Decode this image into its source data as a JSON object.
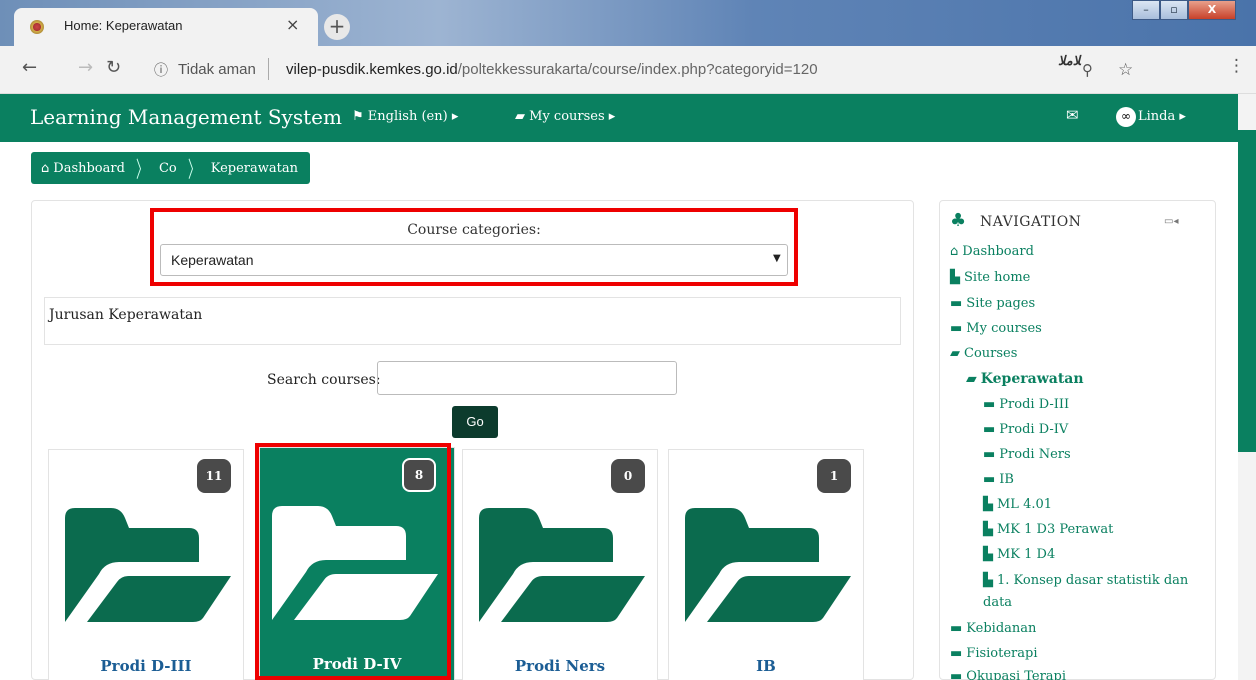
{
  "browser": {
    "tab_title": "Home: Keperawatan",
    "tab_close": "×",
    "new_tab": "+",
    "security": "Tidak aman",
    "url_host": "vilep-pusdik.kemkes.go.id",
    "url_path": "/poltekkessurakarta/course/index.php?categoryid=120",
    "extension_label": "ﻼﻣﻼ",
    "window_buttons": [
      "–",
      "▫",
      "X"
    ]
  },
  "navbar": {
    "brand": "Learning Management System",
    "language": "English (en) ▸",
    "my_courses": "My courses ▸",
    "user": "Linda ▸"
  },
  "breadcrumb": [
    "Dashboard",
    "Co",
    "Keperawatan"
  ],
  "categories": {
    "label": "Course categories:",
    "selected": "Keperawatan",
    "description": "Jurusan Keperawatan"
  },
  "search": {
    "label": "Search courses:",
    "go": "Go"
  },
  "tiles": [
    {
      "name": "Prodi D-III",
      "count": "11"
    },
    {
      "name": "Prodi D-IV",
      "count": "8"
    },
    {
      "name": "Prodi Ners",
      "count": "0"
    },
    {
      "name": "IB",
      "count": "1"
    }
  ],
  "navigation": {
    "title": "NAVIGATION",
    "items": [
      {
        "label": "Dashboard",
        "icon": "home-icon"
      },
      {
        "label": "Site home",
        "icon": "file-icon"
      },
      {
        "label": "Site pages",
        "icon": "folder-icon"
      },
      {
        "label": "My courses",
        "icon": "folder-icon"
      },
      {
        "label": "Courses",
        "icon": "folder-open-icon"
      },
      {
        "label": "Keperawatan",
        "icon": "folder-open-icon"
      },
      {
        "label": "Prodi D-III",
        "icon": "folder-icon"
      },
      {
        "label": "Prodi D-IV",
        "icon": "folder-icon"
      },
      {
        "label": "Prodi Ners",
        "icon": "folder-icon"
      },
      {
        "label": "IB",
        "icon": "folder-icon"
      },
      {
        "label": "ML 4.01",
        "icon": "file-icon"
      },
      {
        "label": "MK 1 D3 Perawat",
        "icon": "file-icon"
      },
      {
        "label": "MK 1 D4",
        "icon": "file-icon"
      },
      {
        "label": "1. Konsep dasar statistik dan",
        "icon": "file-icon"
      },
      {
        "label": "data",
        "icon": ""
      },
      {
        "label": "Kebidanan",
        "icon": "folder-icon"
      },
      {
        "label": "Fisioterapi",
        "icon": "folder-icon"
      },
      {
        "label": "Okupasi Terapi",
        "icon": "folder-icon"
      }
    ]
  },
  "colors": {
    "brand_green": "#0a8060",
    "highlight_red": "#e00",
    "link_blue": "#1b5d94"
  }
}
